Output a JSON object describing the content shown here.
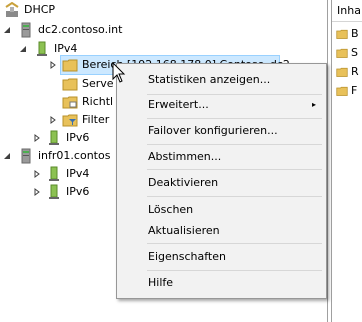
{
  "tree": {
    "root": {
      "label": "DHCP",
      "icon": "dhcp-icon"
    },
    "servers": [
      {
        "label": "dc2.contoso.int",
        "icon": "server-icon",
        "children": {
          "ipv4": {
            "label": "IPv4",
            "children": {
              "scope": "Bereich [192.168.178.0] Contoso_dc2",
              "server_options": "Serve",
              "policies": "Richtl",
              "filter": "Filter"
            }
          },
          "ipv6": {
            "label": "IPv6"
          }
        }
      },
      {
        "label": "infr01.contos",
        "icon": "server-icon",
        "children": {
          "ipv4": {
            "label": "IPv4"
          },
          "ipv6": {
            "label": "IPv6"
          }
        }
      }
    ]
  },
  "right_pane": {
    "header": "Inha",
    "items": [
      "B",
      "S",
      "R",
      "F"
    ]
  },
  "context_menu": {
    "items": [
      {
        "label": "Statistiken anzeigen...",
        "submenu": false
      },
      {
        "label": "Erweitert...",
        "submenu": true
      },
      {
        "label": "Failover konfigurieren...",
        "submenu": false
      },
      {
        "label": "Abstimmen...",
        "submenu": false
      },
      {
        "label": "Deaktivieren",
        "submenu": false
      },
      {
        "label": "Löschen",
        "submenu": false
      },
      {
        "label": "Aktualisieren",
        "submenu": false
      },
      {
        "label": "Eigenschaften",
        "submenu": false
      },
      {
        "label": "Hilfe",
        "submenu": false
      }
    ],
    "submenu_arrow": "▸"
  },
  "colors": {
    "selection_bg": "#cce8ff",
    "selection_border": "#99d1ff",
    "menu_bg": "#f2f2f2",
    "folder": "#e8c15a"
  }
}
